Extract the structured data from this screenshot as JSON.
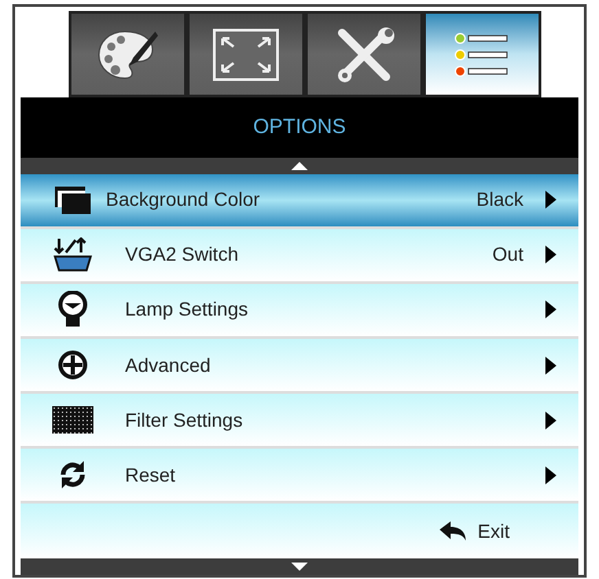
{
  "tabs": [
    {
      "kind": "palette",
      "selected": false
    },
    {
      "kind": "display",
      "selected": false
    },
    {
      "kind": "tools",
      "selected": false
    },
    {
      "kind": "options",
      "selected": true
    }
  ],
  "header": {
    "title": "OPTIONS"
  },
  "items": [
    {
      "kind": "background",
      "label": "Background Color",
      "value": "Black",
      "selected": true
    },
    {
      "kind": "vga",
      "label": "VGA2 Switch",
      "value": "Out",
      "selected": false
    },
    {
      "kind": "lamp",
      "label": "Lamp Settings",
      "selected": false
    },
    {
      "kind": "advanced",
      "label": "Advanced",
      "selected": false
    },
    {
      "kind": "filter",
      "label": "Filter Settings",
      "selected": false
    },
    {
      "kind": "reset",
      "label": "Reset",
      "selected": false
    }
  ],
  "exit": {
    "label": "Exit"
  }
}
